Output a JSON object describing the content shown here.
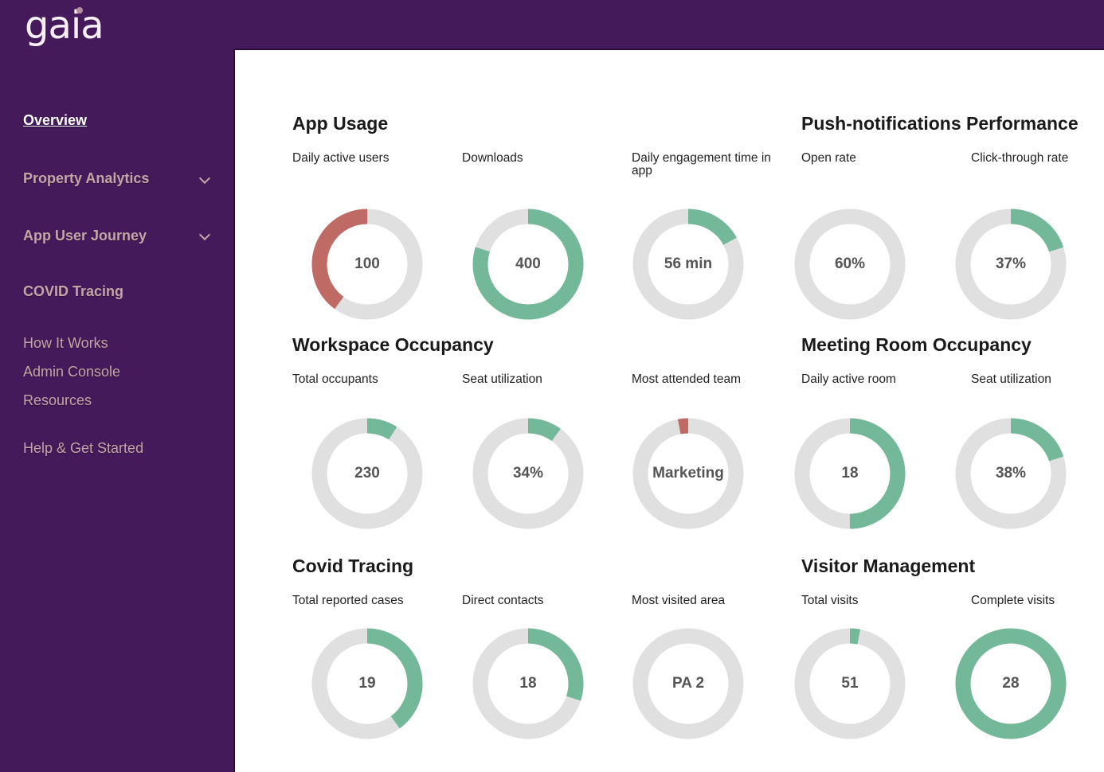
{
  "app": {
    "logo": "gaia"
  },
  "colors": {
    "sidebar_bg": "#451a5a",
    "ring_track": "#e0e0e0",
    "green": "#74b89a",
    "red": "#c06a66"
  },
  "sidebar": {
    "items": [
      {
        "label": "Overview",
        "active": true
      },
      {
        "label": "Property Analytics",
        "expandable": true
      },
      {
        "label": "App User Journey",
        "expandable": true
      },
      {
        "label": "COVID Tracing"
      },
      {
        "label": "How It Works"
      },
      {
        "label": "Admin Console"
      },
      {
        "label": "Resources"
      },
      {
        "label": "Help & Get Started"
      }
    ]
  },
  "sections": [
    {
      "title": "App Usage",
      "metrics": [
        {
          "label": "Daily active users",
          "value": "100",
          "fraction": 0.4,
          "color": "red",
          "direction": "ccw"
        },
        {
          "label": "Downloads",
          "value": "400",
          "fraction": 0.8,
          "color": "green",
          "direction": "cw"
        },
        {
          "label": "Daily engagement time in app",
          "value": "56 min",
          "fraction": 0.17,
          "color": "green",
          "direction": "cw"
        }
      ]
    },
    {
      "title": "Push-notifications Performance",
      "metrics": [
        {
          "label": "Open rate",
          "value": "60%",
          "fraction": 0,
          "color": "green",
          "direction": "cw"
        },
        {
          "label": "Click-through rate",
          "value": "37%",
          "fraction": 0.2,
          "color": "green",
          "direction": "cw"
        }
      ]
    },
    {
      "title": "Workspace Occupancy",
      "metrics": [
        {
          "label": "Total occupants",
          "value": "230",
          "fraction": 0.09,
          "color": "green",
          "direction": "cw"
        },
        {
          "label": "Seat utilization",
          "value": "34%",
          "fraction": 0.1,
          "color": "green",
          "direction": "cw"
        },
        {
          "label": "Most attended team",
          "value": "Marketing",
          "fraction": 0.03,
          "color": "red",
          "direction": "ccw"
        }
      ]
    },
    {
      "title": "Meeting Room Occupancy",
      "metrics": [
        {
          "label": "Daily active room",
          "value": "18",
          "fraction": 0.5,
          "color": "green",
          "direction": "cw"
        },
        {
          "label": "Seat utilization",
          "value": "38%",
          "fraction": 0.2,
          "color": "green",
          "direction": "cw"
        }
      ]
    },
    {
      "title": "Covid Tracing",
      "metrics": [
        {
          "label": "Total reported cases",
          "value": "19",
          "fraction": 0.4,
          "color": "green",
          "direction": "cw"
        },
        {
          "label": "Direct contacts",
          "value": "18",
          "fraction": 0.3,
          "color": "green",
          "direction": "cw"
        },
        {
          "label": "Most visited area",
          "value": "PA 2",
          "fraction": 0,
          "color": "green",
          "direction": "cw"
        }
      ]
    },
    {
      "title": "Visitor Management",
      "metrics": [
        {
          "label": "Total visits",
          "value": "51",
          "fraction": 0.03,
          "color": "green",
          "direction": "cw"
        },
        {
          "label": "Complete visits",
          "value": "28",
          "fraction": 1.0,
          "color": "green",
          "direction": "cw"
        }
      ]
    }
  ]
}
